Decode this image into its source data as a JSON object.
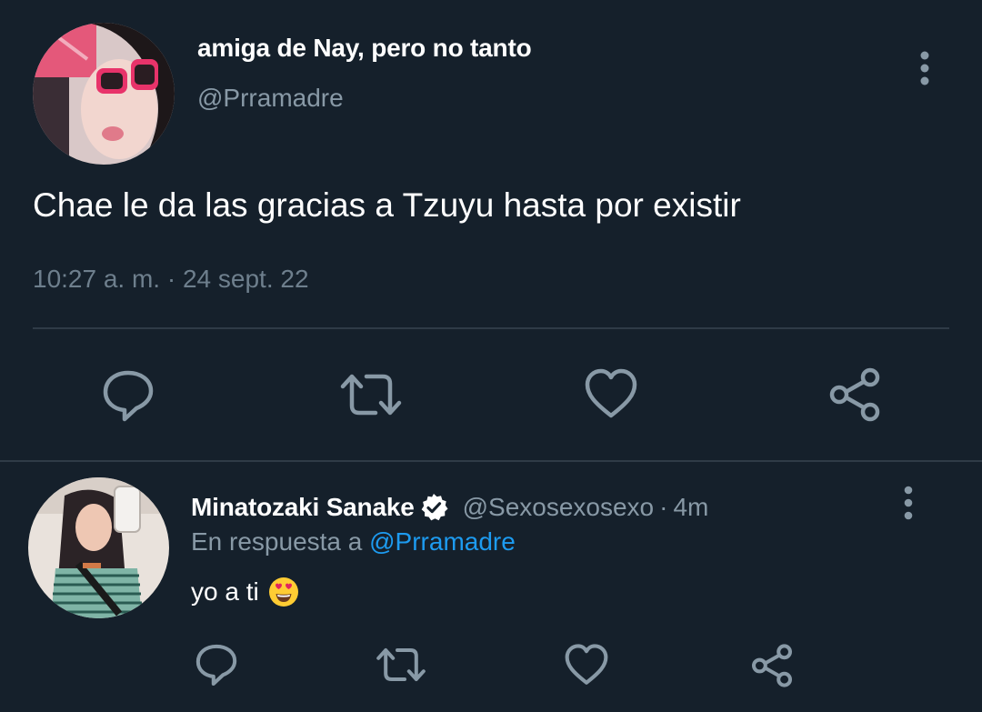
{
  "main_tweet": {
    "display_name": "amiga de Nay, pero no tanto",
    "handle": "@Prramadre",
    "avatar": "profile-photo-icon",
    "more": "more-vertical-icon",
    "text": "Chae le da las gracias a Tzuyu hasta por existir",
    "timestamp": "10:27 a. m. · 24 sept. 22",
    "actions": [
      {
        "name": "reply",
        "icon": "reply-icon"
      },
      {
        "name": "retweet",
        "icon": "retweet-icon"
      },
      {
        "name": "like",
        "icon": "heart-icon"
      },
      {
        "name": "share",
        "icon": "share-icon"
      }
    ]
  },
  "reply": {
    "display_name": "Minatozaki Sanake",
    "verified": true,
    "handle": "@Sexosexosexo",
    "separator": "·",
    "time": "4m",
    "replying_label": "En respuesta a",
    "replying_mention": "@Prramadre",
    "text": "yo a ti",
    "emoji": "heart-eyes-emoji-icon",
    "avatar": "profile-photo-icon",
    "more": "more-vertical-icon",
    "actions": [
      {
        "name": "reply",
        "icon": "reply-icon"
      },
      {
        "name": "retweet",
        "icon": "retweet-icon"
      },
      {
        "name": "like",
        "icon": "heart-icon"
      },
      {
        "name": "share",
        "icon": "share-icon"
      }
    ]
  },
  "colors": {
    "background": "#15202b",
    "text_primary": "#ffffff",
    "text_secondary": "#8899a6",
    "link": "#1d9bf0",
    "divider": "#2f3b47",
    "icon": "#8899a6"
  }
}
